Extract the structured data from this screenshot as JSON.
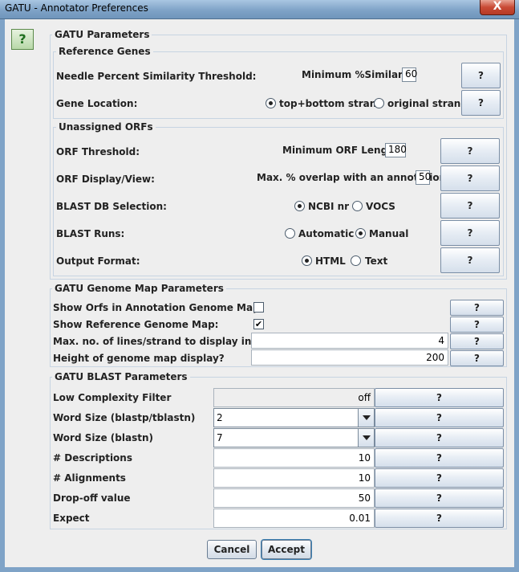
{
  "window": {
    "title": "GATU - Annotator Preferences",
    "close_label": "X"
  },
  "help_icon_label": "?",
  "gatu_params": {
    "legend": "GATU Parameters",
    "reference_genes": {
      "legend": "Reference Genes",
      "needle_label": "Needle Percent Similarity Threshold:",
      "min_similarity_label": "Minimum %Similarity",
      "min_similarity_value": "60",
      "gene_location_label": "Gene Location:",
      "loc_opt1": "top+bottom strand",
      "loc_opt2": "original strand",
      "help": "?"
    },
    "unassigned_orfs": {
      "legend": "Unassigned ORFs",
      "orf_threshold_label": "ORF Threshold:",
      "min_orf_label": "Minimum ORF Length",
      "min_orf_value": "180",
      "orf_display_label": "ORF Display/View:",
      "max_overlap_label": "Max. % overlap with an annotation",
      "max_overlap_value": "50",
      "blast_db_label": "BLAST DB Selection:",
      "db_opt1": "NCBI nr",
      "db_opt2": "VOCS",
      "blast_runs_label": "BLAST Runs:",
      "runs_opt1": "Automatic",
      "runs_opt2": "Manual",
      "output_format_label": "Output Format:",
      "fmt_opt1": "HTML",
      "fmt_opt2": "Text"
    }
  },
  "genome_map": {
    "legend": "GATU Genome Map Parameters",
    "show_orfs_label": "Show Orfs in Annotation Genome Map:",
    "show_ref_label": "Show Reference Genome Map:",
    "check_mark": "✔",
    "max_lines_label": "Max. no. of lines/strand to display in map?",
    "max_lines_value": "4",
    "height_label": "Height of genome map display?",
    "height_value": "200"
  },
  "blast_params": {
    "legend": "GATU BLAST Parameters",
    "low_complexity_label": "Low Complexity Filter",
    "low_complexity_value": "off",
    "word_size_blastp_label": "Word Size (blastp/tblastn)",
    "word_size_blastp_value": "2",
    "word_size_blastn_label": "Word Size (blastn)",
    "word_size_blastn_value": "7",
    "descriptions_label": "# Descriptions",
    "descriptions_value": "10",
    "alignments_label": "# Alignments",
    "alignments_value": "10",
    "dropoff_label": "Drop-off value",
    "dropoff_value": "50",
    "expect_label": "Expect",
    "expect_value": "0.01"
  },
  "buttons": {
    "cancel": "Cancel",
    "accept": "Accept"
  }
}
